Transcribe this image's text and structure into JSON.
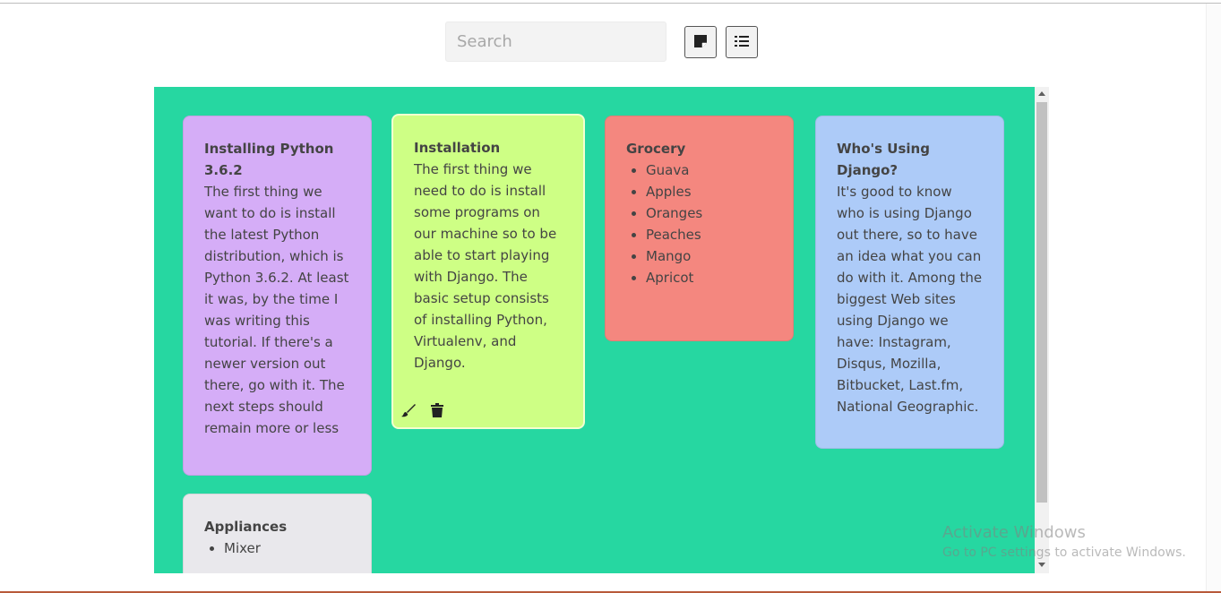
{
  "search": {
    "placeholder": "Search",
    "value": ""
  },
  "toolbar": {
    "grid_view_icon": "sticky-note-icon",
    "list_view_icon": "list-icon"
  },
  "notes": [
    {
      "title": "Installing Python 3.6.2",
      "body": "The first thing we want to do is install the latest Python distribution, which is Python 3.6.2. At least it was, by the time I was writing this tutorial. If there's a newer version out there, go with it. The next steps should remain more or less",
      "color": "#d5adf7"
    },
    {
      "title": "Installation",
      "body": "The first thing we need to do is install some programs on our machine so to be able to start playing with Django. The basic setup consists of installing Python, Virtualenv, and Django.",
      "color": "#ceff85",
      "actions": {
        "edit_icon": "paintbrush-icon",
        "delete_icon": "trash-icon"
      }
    },
    {
      "title": "Grocery",
      "items": [
        "Guava",
        "Apples",
        "Oranges",
        "Peaches",
        "Mango",
        "Apricot"
      ],
      "color": "#f4877f"
    },
    {
      "title": "Who's Using Django?",
      "body": "It's good to know who is using Django out there, so to have an idea what you can do with it. Among the biggest Web sites using Django we have: Instagram, Disqus, Mozilla, Bitbucket, Last.fm, National Geographic.",
      "color": "#adcbf8"
    },
    {
      "title": "Appliances",
      "items": [
        "Mixer"
      ],
      "color": "#e9e8ec"
    }
  ],
  "board": {
    "background": "#26d7a1"
  },
  "watermark": {
    "title": "Activate Windows",
    "subtitle": "Go to PC settings to activate Windows."
  }
}
